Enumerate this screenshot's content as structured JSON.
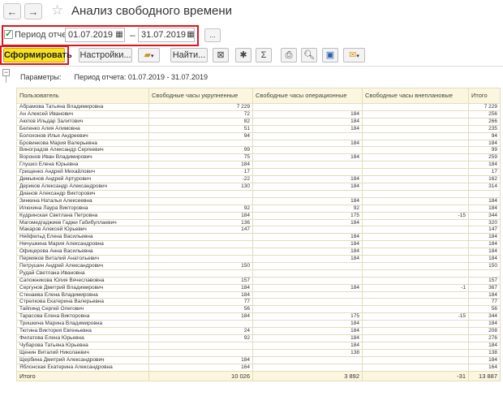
{
  "window": {
    "title": "Анализ свободного времени",
    "back_icon": "←",
    "forward_icon": "→",
    "star_icon": "☆"
  },
  "params": {
    "period_checked": true,
    "period_label": "Период отчета:",
    "date_from": "01.07.2019",
    "date_to": "31.07.2019",
    "dash": "–",
    "more_label": "..."
  },
  "toolbar": {
    "generate_label": "Сформировать",
    "settings_label": "Настройки...",
    "find_label": "Найти...",
    "sum_icon": "Σ"
  },
  "report": {
    "params_label": "Параметры:",
    "params_value": "Период отчета: 01.07.2019 - 31.07.2019",
    "columns": [
      "Пользователь",
      "Свободные часы укрупненные",
      "Свободные часы операционные",
      "Свободные часы внеплановые",
      "Итого"
    ],
    "rows": [
      [
        "Абрамова Татьяна Владимировна",
        "7 229",
        "",
        "",
        "7 229"
      ],
      [
        "Ан Алексей Иванович",
        "72",
        "184",
        "",
        "256"
      ],
      [
        "Аюпов Ильдар Залитович",
        "82",
        "184",
        "",
        "266"
      ],
      [
        "Беленко Алия Алимовна",
        "51",
        "184",
        "",
        "235"
      ],
      [
        "Болохонов Илья Андреевич",
        "94",
        "",
        "",
        "94"
      ],
      [
        "Бровинкова Мария Валерьевна",
        "",
        "184",
        "",
        "184"
      ],
      [
        "Виноградов Александр Сергеевич",
        "99",
        "",
        "",
        "99"
      ],
      [
        "Воронов Иван Владимирович",
        "75",
        "184",
        "",
        "259"
      ],
      [
        "Глушко Елена Юрьевна",
        "184",
        "",
        "",
        "184"
      ],
      [
        "Грищенко Андрей Михайлович",
        "17",
        "",
        "",
        "17"
      ],
      [
        "Демьянов Андрей Артурович",
        "-22",
        "184",
        "",
        "162"
      ],
      [
        "Дериков Александр Александрович",
        "130",
        "184",
        "",
        "314"
      ],
      [
        "Дианов Александр Викторович",
        "",
        "",
        "",
        ""
      ],
      [
        "Зинкина Наталья Алексеевна",
        "",
        "184",
        "",
        "184"
      ],
      [
        "Илюхина Лаура Викторовна",
        "92",
        "92",
        "",
        "184"
      ],
      [
        "Кудринская Светлана Петровна",
        "184",
        "175",
        "-15",
        "344"
      ],
      [
        "Магомедгаджиев Гаджи Габибуллаевич",
        "136",
        "184",
        "",
        "320"
      ],
      [
        "Макаров Алексей Юрьевич",
        "147",
        "",
        "",
        "147"
      ],
      [
        "Нейфельд Елена Васильевна",
        "",
        "184",
        "",
        "184"
      ],
      [
        "Нечушкина Мария Александровна",
        "",
        "184",
        "",
        "184"
      ],
      [
        "Офицерова Анна Васильевна",
        "",
        "184",
        "",
        "184"
      ],
      [
        "Пермяков Виталий Анатольевич",
        "",
        "184",
        "",
        "184"
      ],
      [
        "Петрушин Андрей Александрович",
        "150",
        "",
        "",
        "150"
      ],
      [
        "Рудай Светлана Ивановна",
        "",
        "",
        "",
        ""
      ],
      [
        "Сапожникова Юлия Вячеславовна",
        "157",
        "",
        "",
        "157"
      ],
      [
        "Сергунов Дмитрий Владимирович",
        "184",
        "184",
        "-1",
        "367"
      ],
      [
        "Стенаева Елена Владимировна",
        "184",
        "",
        "",
        "184"
      ],
      [
        "Стрелкова Екатерина Валерьевна",
        "77",
        "",
        "",
        "77"
      ],
      [
        "Тайпинд Сергей Олегович",
        "56",
        "",
        "",
        "56"
      ],
      [
        "Тарасова Елена Викторовна",
        "184",
        "175",
        "-15",
        "344"
      ],
      [
        "Тришкина Марина Владимировна",
        "",
        "184",
        "",
        "184"
      ],
      [
        "Тютина Виктория Евгеньевна",
        "24",
        "184",
        "",
        "208"
      ],
      [
        "Филатова Елена Юрьевна",
        "92",
        "184",
        "",
        "276"
      ],
      [
        "Чубарова Татьяна Юрьевна",
        "",
        "184",
        "",
        "184"
      ],
      [
        "Щенин Виталий Николаевич",
        "",
        "138",
        "",
        "138"
      ],
      [
        "Щербина Дмитрий Александрович",
        "184",
        "",
        "",
        "184"
      ],
      [
        "Яблонская Екатерина Александровна",
        "164",
        "",
        "",
        "164"
      ]
    ],
    "total": [
      "Итого",
      "10 026",
      "3 892",
      "-31",
      "13 887"
    ]
  }
}
